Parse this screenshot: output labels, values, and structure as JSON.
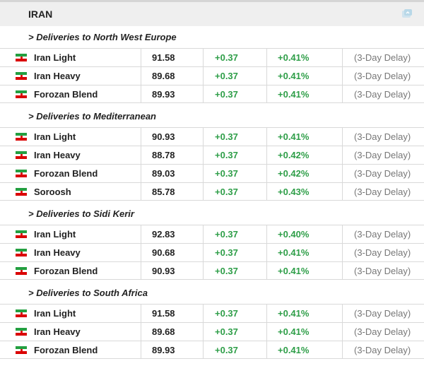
{
  "header": {
    "title": "IRAN",
    "icon": "refresh-chart-icon"
  },
  "colors": {
    "positive": "#2e9e48",
    "delay": "#777777",
    "header_bg": "#efefef",
    "flag_green": "#239f40",
    "flag_red": "#da0000"
  },
  "sections": [
    {
      "label": "> Deliveries to North West Europe",
      "rows": [
        {
          "name": "Iran Light",
          "price": "91.58",
          "change": "+0.37",
          "pct": "+0.41%",
          "delay": "(3-Day Delay)"
        },
        {
          "name": "Iran Heavy",
          "price": "89.68",
          "change": "+0.37",
          "pct": "+0.41%",
          "delay": "(3-Day Delay)"
        },
        {
          "name": "Forozan Blend",
          "price": "89.93",
          "change": "+0.37",
          "pct": "+0.41%",
          "delay": "(3-Day Delay)"
        }
      ]
    },
    {
      "label": "> Deliveries to Mediterranean",
      "rows": [
        {
          "name": "Iran Light",
          "price": "90.93",
          "change": "+0.37",
          "pct": "+0.41%",
          "delay": "(3-Day Delay)"
        },
        {
          "name": "Iran Heavy",
          "price": "88.78",
          "change": "+0.37",
          "pct": "+0.42%",
          "delay": "(3-Day Delay)"
        },
        {
          "name": "Forozan Blend",
          "price": "89.03",
          "change": "+0.37",
          "pct": "+0.42%",
          "delay": "(3-Day Delay)"
        },
        {
          "name": "Soroosh",
          "price": "85.78",
          "change": "+0.37",
          "pct": "+0.43%",
          "delay": "(3-Day Delay)"
        }
      ]
    },
    {
      "label": "> Deliveries to Sidi Kerir",
      "rows": [
        {
          "name": "Iran Light",
          "price": "92.83",
          "change": "+0.37",
          "pct": "+0.40%",
          "delay": "(3-Day Delay)"
        },
        {
          "name": "Iran Heavy",
          "price": "90.68",
          "change": "+0.37",
          "pct": "+0.41%",
          "delay": "(3-Day Delay)"
        },
        {
          "name": "Forozan Blend",
          "price": "90.93",
          "change": "+0.37",
          "pct": "+0.41%",
          "delay": "(3-Day Delay)"
        }
      ]
    },
    {
      "label": "> Deliveries to South Africa",
      "rows": [
        {
          "name": "Iran Light",
          "price": "91.58",
          "change": "+0.37",
          "pct": "+0.41%",
          "delay": "(3-Day Delay)"
        },
        {
          "name": "Iran Heavy",
          "price": "89.68",
          "change": "+0.37",
          "pct": "+0.41%",
          "delay": "(3-Day Delay)"
        },
        {
          "name": "Forozan Blend",
          "price": "89.93",
          "change": "+0.37",
          "pct": "+0.41%",
          "delay": "(3-Day Delay)"
        }
      ]
    }
  ]
}
